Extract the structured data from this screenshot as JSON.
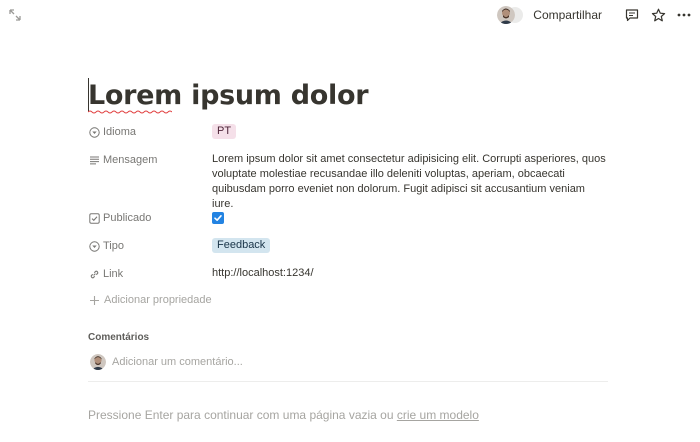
{
  "topbar": {
    "expand_icon": "expand-icon",
    "share_label": "Compartilhar",
    "comment_icon": "comment-icon",
    "favorite_icon": "star-icon",
    "more_icon": "more-icon"
  },
  "page": {
    "title": "Lorem ipsum dolor"
  },
  "properties": [
    {
      "label": "Idioma",
      "icon": "select-icon",
      "value": "PT"
    },
    {
      "label": "Mensagem",
      "icon": "text-lines-icon",
      "value": "Lorem ipsum dolor sit amet consectetur adipisicing elit. Corrupti asperiores, quos voluptate molestiae recusandae illo deleniti voluptas, aperiam, obcaecati quibusdam porro eveniet non dolorum. Fugit adipisci sit accusantium veniam iure."
    },
    {
      "label": "Publicado",
      "icon": "checkbox-icon",
      "value": true
    },
    {
      "label": "Tipo",
      "icon": "select-icon",
      "value": "Feedback"
    },
    {
      "label": "Link",
      "icon": "link-icon",
      "value": "http://localhost:1234/"
    }
  ],
  "add_property": {
    "label": "Adicionar propriedade"
  },
  "comments": {
    "heading": "Comentários",
    "placeholder": "Adicionar um comentário..."
  },
  "footer": {
    "text": "Pressione Enter para continuar com uma página vazia ou ",
    "link": "crie um modelo"
  },
  "colors": {
    "accent_blue": "#2383e2",
    "tag_pt_bg": "#f5e0e9",
    "tag_feedback_bg": "#d3e5ef",
    "text": "#37352f",
    "muted": "#787774"
  }
}
